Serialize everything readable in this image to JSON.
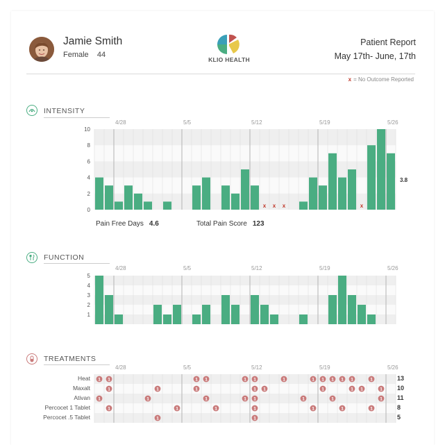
{
  "patient": {
    "name": "Jamie Smith",
    "gender": "Female",
    "age": "44"
  },
  "brand": {
    "name": "KLIO HEALTH"
  },
  "report": {
    "title": "Patient Report",
    "dates": "May 17th- June, 17th"
  },
  "legend": {
    "marker": "x",
    "text": "= No Outcome Reported"
  },
  "sections": {
    "intensity": "INTENSITY",
    "function": "FUNCTION",
    "treatments": "TREATMENTS"
  },
  "stats": {
    "pain_free_label": "Pain Free Days",
    "pain_free_value": "4.6",
    "total_pain_label": "Total Pain Score",
    "total_pain_value": "123"
  },
  "colors": {
    "bar": "#4aad82",
    "marker": "#c0392b",
    "pill": "#c97a7a",
    "accent": "#4aad82"
  },
  "chart_data": [
    {
      "type": "bar",
      "title": "INTENSITY",
      "date_labels": [
        "4/28",
        "5/5",
        "5/12",
        "5/19",
        "5/26"
      ],
      "y_ticks": [
        "0",
        "2",
        "4",
        "6",
        "8",
        "10"
      ],
      "ylim": [
        0,
        10
      ],
      "values": [
        4,
        3,
        1,
        3,
        2,
        1,
        0,
        1,
        0,
        0,
        3,
        4,
        0,
        3,
        2,
        5,
        3,
        null,
        null,
        null,
        0,
        1,
        4,
        3,
        7,
        4,
        5,
        null,
        8,
        10,
        7
      ],
      "missing_marker": "x",
      "side_value": "3.8"
    },
    {
      "type": "bar",
      "title": "FUNCTION",
      "date_labels": [
        "4/28",
        "5/5",
        "5/12",
        "5/19",
        "5/26"
      ],
      "y_ticks": [
        "1",
        "2",
        "3",
        "4",
        "5"
      ],
      "ylim": [
        0,
        5
      ],
      "values": [
        5,
        3,
        1,
        0,
        0,
        0,
        2,
        1,
        2,
        0,
        1,
        2,
        0,
        3,
        2,
        0,
        3,
        2,
        1,
        0,
        0,
        1,
        0,
        0,
        3,
        5,
        3,
        2,
        1,
        0,
        0
      ]
    },
    {
      "type": "table",
      "title": "TREATMENTS",
      "date_labels": [
        "4/28",
        "5/5",
        "5/12",
        "5/19",
        "5/26"
      ],
      "pill_text": "1",
      "rows": [
        {
          "name": "Heat",
          "total": "13",
          "days": [
            0,
            1,
            10,
            11,
            15,
            16,
            19,
            22,
            23,
            24,
            25,
            26,
            28
          ]
        },
        {
          "name": "Maxalt",
          "total": "10",
          "days": [
            1,
            6,
            10,
            16,
            17,
            23,
            26,
            27,
            29
          ]
        },
        {
          "name": "Ativan",
          "total": "11",
          "days": [
            0,
            5,
            11,
            15,
            16,
            21,
            24,
            29
          ]
        },
        {
          "name": "Percocet 1 Tablet",
          "total": "8",
          "days": [
            1,
            8,
            12,
            16,
            22,
            25,
            28
          ]
        },
        {
          "name": "Percocet .5 Tablet",
          "total": "5",
          "days": [
            6,
            16
          ]
        }
      ]
    }
  ]
}
